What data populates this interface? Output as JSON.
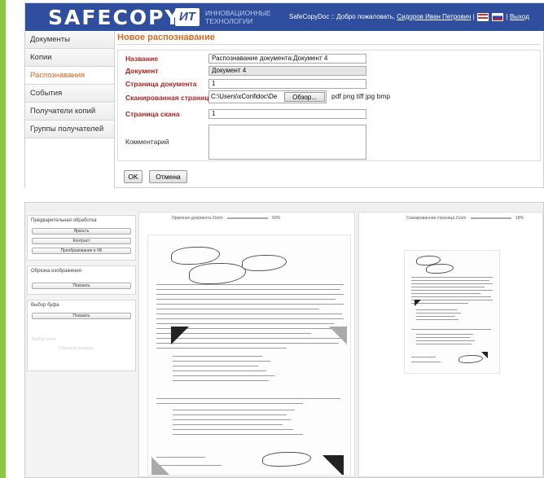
{
  "header": {
    "logo": "SAFECOPY",
    "logo_mark": "ИТ",
    "company_line1": "ИННОВАЦИОННЫЕ",
    "company_line2": "ТЕХНОЛОГИИ",
    "app_name": "SafeCopyDoc",
    "separator": "::",
    "welcome": "Добро пожаловать,",
    "user": "Сидоров Иван Петрович",
    "logout": "Выход"
  },
  "sidebar": {
    "items": [
      {
        "label": "Документы"
      },
      {
        "label": "Копии"
      },
      {
        "label": "Распознавания",
        "active": true
      },
      {
        "label": "События"
      },
      {
        "label": "Получатели копий"
      },
      {
        "label": "Группы получателей"
      }
    ]
  },
  "form": {
    "title": "Новое распознавание",
    "name_label": "Название",
    "name_value": "Распознавание документа:Документ 4",
    "document_label": "Документ",
    "document_value": "Документ 4",
    "doc_page_label": "Страница документа",
    "doc_page_value": "1",
    "scan_label": "Сканированная страница",
    "scan_path": "C:\\Users\\xConfidoc\\De",
    "browse_label": "Обзор...",
    "formats": "pdf png tiff jpg bmp",
    "scan_page_label": "Страница скана",
    "scan_page_value": "1",
    "comment_label": "Комментарий",
    "ok_label": "OK",
    "cancel_label": "Отмена"
  },
  "viewer": {
    "preprocess_title": "Предварительная обработка",
    "brightness_btn": "Яркость",
    "contrast_btn": "Контраст",
    "bw_btn": "Преобразование в ЧБ",
    "crop_title": "Обрезка изображения",
    "crop_show_btn": "Показать",
    "buffer_title": "Выбор буфа",
    "buffer_show_btn": "Показать",
    "faded_1": "Выбор точек",
    "faded_2": "Сбросить границы",
    "original_label": "Оригинал документа",
    "original_zoom_label": "Zoom",
    "original_zoom_value": "60%",
    "scanned_label": "Сканированная страница",
    "scanned_zoom_label": "Zoom",
    "scanned_zoom_value": "18%"
  },
  "colors": {
    "header_bg": "#2f4f9e",
    "accent": "#e0681c",
    "label_red": "#b22222",
    "green_bar": "#8dc63f"
  }
}
